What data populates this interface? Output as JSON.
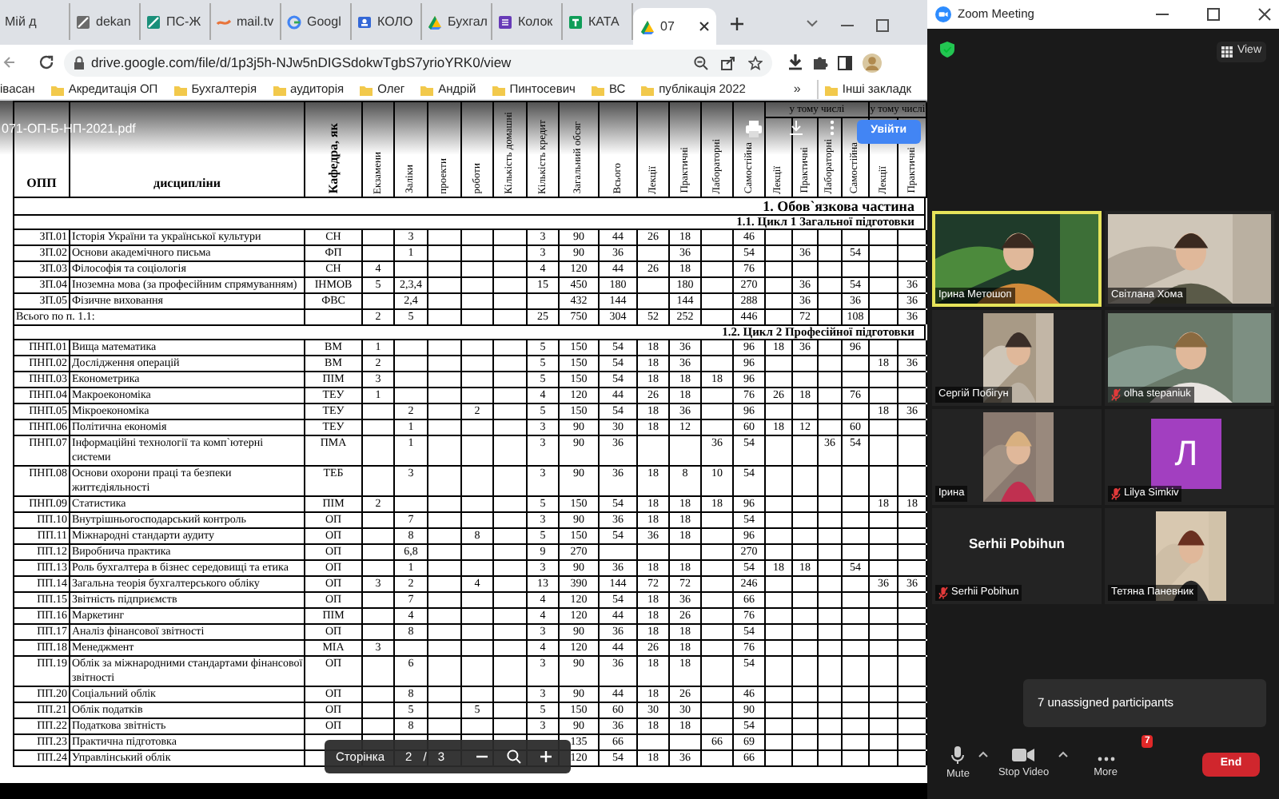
{
  "browser": {
    "tabs": [
      {
        "label": "Мій д",
        "selected": false
      },
      {
        "label": "dekan",
        "selected": false
      },
      {
        "label": "ПС-Ж",
        "selected": false
      },
      {
        "label": "mail.tv",
        "selected": false
      },
      {
        "label": "Googl",
        "selected": false
      },
      {
        "label": "КОЛО",
        "selected": false
      },
      {
        "label": "Бухгал",
        "selected": false
      },
      {
        "label": "Колок",
        "selected": false
      },
      {
        "label": "КАТА",
        "selected": false
      },
      {
        "label": "07",
        "selected": true
      }
    ],
    "url": "drive.google.com/file/d/1p3j5h-NJw5nDIGSdokwTgbS7yrioYRK0/view",
    "bookmarks": [
      {
        "label": "івасан",
        "kind": "partial"
      },
      {
        "label": "Акредитація ОП",
        "kind": "folder"
      },
      {
        "label": "Бухгалтерія",
        "kind": "folder"
      },
      {
        "label": "аудиторія",
        "kind": "folder"
      },
      {
        "label": "Олег",
        "kind": "folder"
      },
      {
        "label": "Андрій",
        "kind": "folder"
      },
      {
        "label": "Пинтосевич",
        "kind": "folder"
      },
      {
        "label": "ВС",
        "kind": "folder"
      },
      {
        "label": "публікація 2022",
        "kind": "folder"
      }
    ],
    "bookmarks_overflow": "»",
    "other_bookmarks": "Інші закладк"
  },
  "pdf": {
    "filename": "071-ОП-Б-НП-2021.pdf",
    "sign_in": "Увійти",
    "table": {
      "headers": [
        "ОПП",
        "дисципліни",
        "Кафедра, як",
        "Екзамени",
        "Заліки",
        "проекти",
        "роботи",
        "Кількість домашні",
        "Кількість кредит",
        "Загальний обсяг",
        "Всього",
        "Лекції",
        "Практичні",
        "Лабораторні",
        "Самостійна",
        "Лекції",
        "Практичні",
        "Лабораторні",
        "Самостійна",
        "Лекції",
        "Практичні"
      ],
      "group_headers": [
        "у тому числі",
        "у тому числі"
      ],
      "rows": [
        {
          "kind": "part",
          "text": "1. Обов`язкова частина"
        },
        {
          "kind": "cycle",
          "text": "1.1. Цикл 1 Загальної підготовки"
        },
        {
          "kind": "data",
          "code": "ЗП.01",
          "name": "Історія України та української культури",
          "dept": "СН",
          "values": {
            "tests": "3",
            "credits": "3",
            "total": "90",
            "all": "44",
            "lec": "26",
            "prac": "18",
            "self": "46"
          }
        },
        {
          "kind": "data",
          "code": "ЗП.02",
          "name": "Основи академічного письма",
          "dept": "ФП",
          "values": {
            "tests": "1",
            "credits": "3",
            "total": "90",
            "all": "36",
            "prac": "36",
            "self": "54",
            "a_prac": "36",
            "a_self": "54"
          }
        },
        {
          "kind": "data",
          "code": "ЗП.03",
          "name": "Філософія та соціологія",
          "dept": "СН",
          "values": {
            "exams": "4",
            "credits": "4",
            "total": "120",
            "all": "44",
            "lec": "26",
            "prac": "18",
            "self": "76"
          }
        },
        {
          "kind": "data",
          "code": "ЗП.04",
          "name": "Іноземна мова (за професійним спрямуванням)",
          "dept": "ІНМОВ",
          "values": {
            "exams": "5",
            "tests": "2,3,4",
            "credits": "15",
            "total": "450",
            "all": "180",
            "prac": "180",
            "self": "270",
            "a_prac": "36",
            "a_self": "54",
            "b_prac": "36"
          }
        },
        {
          "kind": "data",
          "code": "ЗП.05",
          "name": "Фізичне виховання",
          "dept": "ФВС",
          "values": {
            "tests": "2,4",
            "total": "432",
            "all": "144",
            "prac": "144",
            "self": "288",
            "a_prac": "36",
            "a_self": "36",
            "b_prac": "36"
          }
        },
        {
          "kind": "total",
          "name": "Всього по п. 1.1:",
          "values": {
            "exams": "2",
            "tests": "5",
            "credits": "25",
            "total": "750",
            "all": "304",
            "lec": "52",
            "prac": "252",
            "self": "446",
            "a_prac": "72",
            "a_self": "108",
            "b_prac": "36"
          }
        },
        {
          "kind": "cycle",
          "text": "1.2. Цикл 2 Професійної підготовки"
        },
        {
          "kind": "data",
          "code": "ПНП.01",
          "name": "Вища математика",
          "dept": "ВМ",
          "values": {
            "exams": "1",
            "credits": "5",
            "total": "150",
            "all": "54",
            "lec": "18",
            "prac": "36",
            "self": "96",
            "a_lec": "18",
            "a_prac": "36",
            "a_self": "96"
          }
        },
        {
          "kind": "data",
          "code": "ПНП.02",
          "name": "Дослідження операцій",
          "dept": "ВМ",
          "values": {
            "exams": "2",
            "credits": "5",
            "total": "150",
            "all": "54",
            "lec": "18",
            "prac": "36",
            "self": "96",
            "b_lec": "18",
            "b_prac": "36"
          }
        },
        {
          "kind": "data",
          "code": "ПНП.03",
          "name": "Економетрика",
          "dept": "ПІМ",
          "values": {
            "exams": "3",
            "credits": "5",
            "total": "150",
            "all": "54",
            "lec": "18",
            "prac": "18",
            "lab": "18",
            "self": "96"
          }
        },
        {
          "kind": "data",
          "code": "ПНП.04",
          "name": "Макроекономіка",
          "dept": "ТЕУ",
          "values": {
            "exams": "1",
            "credits": "4",
            "total": "120",
            "all": "44",
            "lec": "26",
            "prac": "18",
            "self": "76",
            "a_lec": "26",
            "a_prac": "18",
            "a_self": "76"
          }
        },
        {
          "kind": "data",
          "code": "ПНП.05",
          "name": "Мікроекономіка",
          "dept": "ТЕУ",
          "values": {
            "tests": "2",
            "works": "2",
            "credits": "5",
            "total": "150",
            "all": "54",
            "lec": "18",
            "prac": "36",
            "self": "96",
            "b_lec": "18",
            "b_prac": "36"
          }
        },
        {
          "kind": "data",
          "code": "ПНП.06",
          "name": "Політична економія",
          "dept": "ТЕУ",
          "values": {
            "tests": "1",
            "credits": "3",
            "total": "90",
            "all": "30",
            "lec": "18",
            "prac": "12",
            "self": "60",
            "a_lec": "18",
            "a_prac": "12",
            "a_self": "60"
          }
        },
        {
          "kind": "data",
          "code": "ПНП.07",
          "name": "Інформаційні технології та комп`ютерні системи",
          "dept": "ПМА",
          "values": {
            "tests": "1",
            "credits": "3",
            "total": "90",
            "all": "36",
            "lab": "36",
            "self": "54",
            "a_lab": "36",
            "a_self": "54"
          }
        },
        {
          "kind": "data",
          "code": "ПНП.08",
          "name": "Основи охорони праці та безпеки життєдіяльності",
          "dept": "ТЕБ",
          "values": {
            "tests": "3",
            "credits": "3",
            "total": "90",
            "all": "36",
            "lec": "18",
            "prac": "8",
            "lab": "10",
            "self": "54"
          }
        },
        {
          "kind": "data",
          "code": "ПНП.09",
          "name": "Статистика",
          "dept": "ПІМ",
          "values": {
            "exams": "2",
            "credits": "5",
            "total": "150",
            "all": "54",
            "lec": "18",
            "prac": "18",
            "lab": "18",
            "self": "96",
            "b_lec": "18",
            "b_prac": "18"
          }
        },
        {
          "kind": "data",
          "code": "ПП.10",
          "name": "Внутрішньогосподарський контроль",
          "dept": "ОП",
          "values": {
            "tests": "7",
            "credits": "3",
            "total": "90",
            "all": "36",
            "lec": "18",
            "prac": "18",
            "self": "54"
          }
        },
        {
          "kind": "data",
          "code": "ПП.11",
          "name": "Міжнародні стандарти аудиту",
          "dept": "ОП",
          "values": {
            "tests": "8",
            "works": "8",
            "credits": "5",
            "total": "150",
            "all": "54",
            "lec": "36",
            "prac": "18",
            "self": "96"
          }
        },
        {
          "kind": "data",
          "code": "ПП.12",
          "name": "Виробнича практика",
          "dept": "ОП",
          "values": {
            "tests": "6,8",
            "credits": "9",
            "total": "270",
            "self": "270"
          }
        },
        {
          "kind": "data",
          "code": "ПП.13",
          "name": "Роль бухгалтера в бізнес середовищі та етика",
          "dept": "ОП",
          "values": {
            "tests": "1",
            "credits": "3",
            "total": "90",
            "all": "36",
            "lec": "18",
            "prac": "18",
            "self": "54",
            "a_lec": "18",
            "a_prac": "18",
            "a_self": "54"
          }
        },
        {
          "kind": "data",
          "code": "ПП.14",
          "name": "Загальна теорія бухгалтерського обліку",
          "dept": "ОП",
          "values": {
            "exams": "3",
            "tests": "2",
            "works": "4",
            "credits": "13",
            "total": "390",
            "all": "144",
            "lec": "72",
            "prac": "72",
            "self": "246",
            "b_lec": "36",
            "b_prac": "36"
          }
        },
        {
          "kind": "data",
          "code": "ПП.15",
          "name": "Звітність підприємств",
          "dept": "ОП",
          "values": {
            "tests": "7",
            "credits": "4",
            "total": "120",
            "all": "54",
            "lec": "18",
            "prac": "36",
            "self": "66"
          }
        },
        {
          "kind": "data",
          "code": "ПП.16",
          "name": "Маркетинг",
          "dept": "ПІМ",
          "values": {
            "tests": "4",
            "credits": "4",
            "total": "120",
            "all": "44",
            "lec": "18",
            "prac": "26",
            "self": "76"
          }
        },
        {
          "kind": "data",
          "code": "ПП.17",
          "name": "Аналіз фінансової звітності",
          "dept": "ОП",
          "values": {
            "tests": "8",
            "credits": "3",
            "total": "90",
            "all": "36",
            "lec": "18",
            "prac": "18",
            "self": "54"
          }
        },
        {
          "kind": "data",
          "code": "ПП.18",
          "name": "Менеджмент",
          "dept": "МІА",
          "values": {
            "exams": "3",
            "credits": "4",
            "total": "120",
            "all": "44",
            "lec": "26",
            "prac": "18",
            "self": "76"
          }
        },
        {
          "kind": "data",
          "code": "ПП.19",
          "name": "Облік за міжнародними стандартами фінансової звітності",
          "dept": "ОП",
          "values": {
            "tests": "6",
            "credits": "3",
            "total": "90",
            "all": "36",
            "lec": "18",
            "prac": "18",
            "self": "54"
          }
        },
        {
          "kind": "data",
          "code": "ПП.20",
          "name": "Соціальний облік",
          "dept": "ОП",
          "values": {
            "tests": "8",
            "credits": "3",
            "total": "90",
            "all": "44",
            "lec": "18",
            "prac": "26",
            "self": "46"
          }
        },
        {
          "kind": "data",
          "code": "ПП.21",
          "name": "Облік податків",
          "dept": "ОП",
          "values": {
            "tests": "5",
            "works": "5",
            "credits": "5",
            "total": "150",
            "all": "60",
            "lec": "30",
            "prac": "30",
            "self": "90"
          }
        },
        {
          "kind": "data",
          "code": "ПП.22",
          "name": "Податкова звітність",
          "dept": "ОП",
          "values": {
            "tests": "8",
            "credits": "3",
            "total": "90",
            "all": "36",
            "lec": "18",
            "prac": "18",
            "self": "54"
          }
        },
        {
          "kind": "data",
          "code": "ПП.23",
          "name": "Практична підготовка",
          "values": {
            "total": "135",
            "all": "66",
            "lab": "66",
            "self": "69"
          }
        },
        {
          "kind": "data",
          "code": "ПП.24",
          "name": "Управлінський облік",
          "values": {
            "total": "120",
            "all": "54",
            "lec": "18",
            "prac": "36",
            "self": "66"
          }
        }
      ]
    },
    "page_nav": {
      "label": "Сторінка",
      "page": "2",
      "separator": "/",
      "total": "3"
    }
  },
  "zoom": {
    "title": "Zoom Meeting",
    "view": "View",
    "tiles": [
      {
        "kind": "video",
        "name": "Ірина Метошоп",
        "muted": false,
        "speaking": true
      },
      {
        "kind": "video",
        "name": "Світлана Хома",
        "muted": false,
        "speaking": false
      },
      {
        "kind": "portrait",
        "name": "Сергій Побігун",
        "muted": false,
        "speaking": false
      },
      {
        "kind": "video",
        "name": "olha stepaniuk",
        "muted": true,
        "speaking": false
      },
      {
        "kind": "portrait",
        "name": "Ірина",
        "muted": false,
        "speaking": false
      },
      {
        "kind": "avatar",
        "letter": "Л",
        "name": "Lilya Simkiv",
        "muted": true,
        "speaking": false
      },
      {
        "kind": "name",
        "display_name": "Serhii Pobihun",
        "name": "Serhii Pobihun",
        "muted": true,
        "speaking": false
      },
      {
        "kind": "portrait",
        "name": "Тетяна Паневник",
        "muted": false,
        "speaking": false
      }
    ],
    "popup": "7 unassigned participants",
    "toolbar": {
      "mute": "Mute",
      "stop_video": "Stop Video",
      "more": "More",
      "more_badge": "7",
      "end": "End"
    }
  }
}
